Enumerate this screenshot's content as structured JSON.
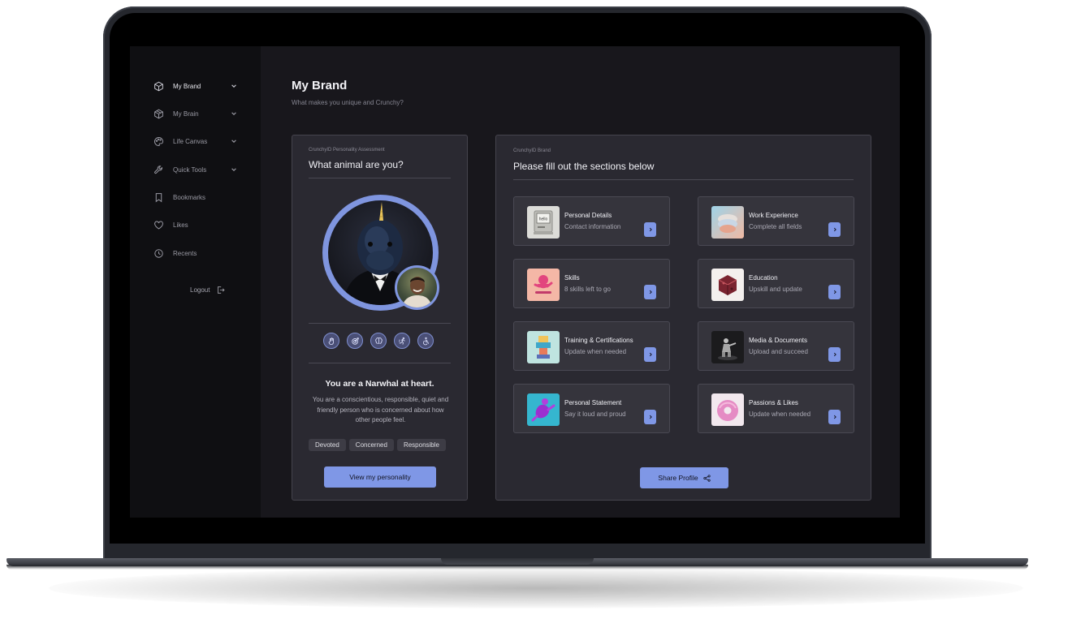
{
  "sidebar": {
    "items": [
      {
        "label": "My Brand",
        "icon": "cube-icon",
        "expandable": true,
        "active": true
      },
      {
        "label": "My Brain",
        "icon": "brain-cube-icon",
        "expandable": true,
        "active": false
      },
      {
        "label": "Life Canvas",
        "icon": "palette-icon",
        "expandable": true,
        "active": false
      },
      {
        "label": "Quick Tools",
        "icon": "wrench-icon",
        "expandable": true,
        "active": false
      },
      {
        "label": "Bookmarks",
        "icon": "bookmark-icon",
        "expandable": false,
        "active": false
      },
      {
        "label": "Likes",
        "icon": "heart-icon",
        "expandable": false,
        "active": false
      },
      {
        "label": "Recents",
        "icon": "clock-icon",
        "expandable": false,
        "active": false
      }
    ],
    "logout_label": "Logout"
  },
  "header": {
    "title": "My Brand",
    "subtitle": "What makes you unique and Crunchy?"
  },
  "personality": {
    "eyebrow": "CrunchyID Personality Assessment",
    "title": "What animal are you?",
    "result_title": "You are a Narwhal at heart.",
    "result_description": "You are a conscientious, responsible, quiet and friendly person who is concerned about how other people feel.",
    "tags": [
      "Devoted",
      "Concerned",
      "Responsible"
    ],
    "trait_icons": [
      "hand-icon",
      "target-icon",
      "brain-icon",
      "running-icon",
      "wheelchair-icon"
    ],
    "cta_label": "View my personality"
  },
  "brand": {
    "eyebrow": "CrunchyID Brand",
    "title": "Please fill out the sections below",
    "cards": [
      {
        "title": "Personal Details",
        "subtitle": "Contact information"
      },
      {
        "title": "Work Experience",
        "subtitle": "Complete all fields"
      },
      {
        "title": "Skills",
        "subtitle": "8 skills left to go"
      },
      {
        "title": "Education",
        "subtitle": "Upskill and update"
      },
      {
        "title": "Training & Certifications",
        "subtitle": "Update when needed"
      },
      {
        "title": "Media & Documents",
        "subtitle": "Upload and succeed"
      },
      {
        "title": "Personal Statement",
        "subtitle": "Say it loud and proud"
      },
      {
        "title": "Passions & Likes",
        "subtitle": "Update when needed"
      }
    ],
    "share_label": "Share Profile"
  },
  "colors": {
    "accent": "#7f97e6",
    "panel": "#2a2931",
    "card": "#35343c",
    "sidebar": "#0f0f12",
    "background": "#18171c"
  }
}
